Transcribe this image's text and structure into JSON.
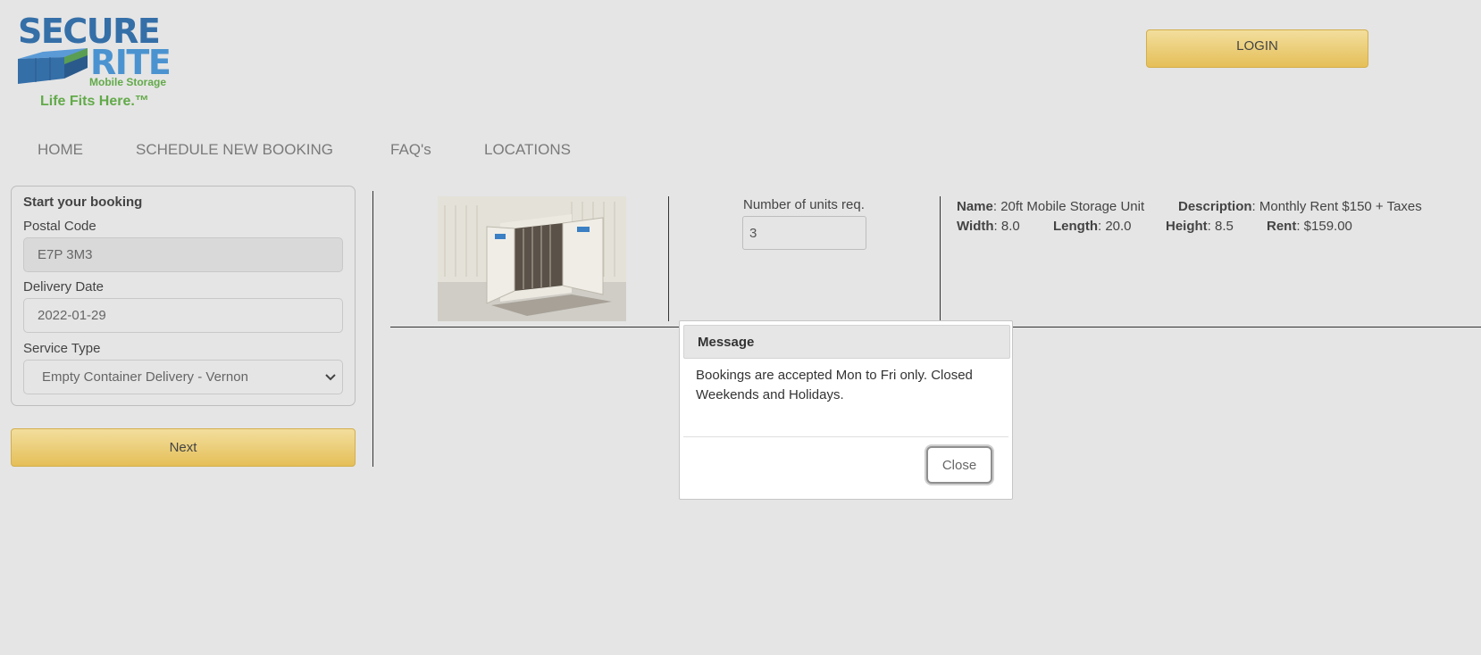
{
  "logo": {
    "line1": "SECURE",
    "line2": "RITE",
    "line3": "Mobile Storage",
    "tagline": "Life Fits Here.™"
  },
  "header": {
    "login_label": "LOGIN"
  },
  "nav": [
    {
      "label": "HOME"
    },
    {
      "label": "SCHEDULE NEW BOOKING"
    },
    {
      "label": "FAQ's"
    },
    {
      "label": "LOCATIONS"
    }
  ],
  "booking": {
    "title": "Start your booking",
    "postal_label": "Postal Code",
    "postal_value": "E7P 3M3",
    "date_label": "Delivery Date",
    "date_value": "2022-01-29",
    "service_label": "Service Type",
    "service_value": "Empty Container Delivery - Vernon",
    "next_label": "Next"
  },
  "product": {
    "units_label": "Number of units req.",
    "units_value": "3",
    "name_key": "Name",
    "name_value": ": 20ft Mobile Storage Unit",
    "description_key": "Description",
    "description_value": ": Monthly Rent $150 + Taxes",
    "width_key": "Width",
    "width_value": ": 8.0",
    "length_key": "Length",
    "length_value": ": 20.0",
    "height_key": "Height",
    "height_value": ": 8.5",
    "rent_key": "Rent",
    "rent_value": ": $159.00"
  },
  "modal": {
    "title": "Message",
    "body": "Bookings are accepted Mon to Fri only. Closed Weekends and Holidays.",
    "close_label": "Close"
  },
  "colors": {
    "background": "#e5e5e5",
    "button_gold": "#e5bf58",
    "logo_blue": "#356fa8",
    "logo_green": "#62aa49"
  }
}
